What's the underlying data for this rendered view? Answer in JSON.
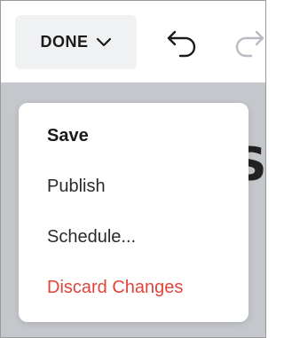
{
  "toolbar": {
    "done_label": "DONE",
    "undo_icon": "undo-icon",
    "redo_icon": "redo-icon",
    "redo_enabled": false
  },
  "backdrop": {
    "partial_text": "S"
  },
  "menu": {
    "items": [
      {
        "label": "Save",
        "style": "bold"
      },
      {
        "label": "Publish",
        "style": "normal"
      },
      {
        "label": "Schedule...",
        "style": "normal"
      },
      {
        "label": "Discard Changes",
        "style": "danger"
      }
    ]
  },
  "colors": {
    "danger": "#e0453a",
    "overlay": "#c4c7cb",
    "button_bg": "#f0f1f3"
  }
}
